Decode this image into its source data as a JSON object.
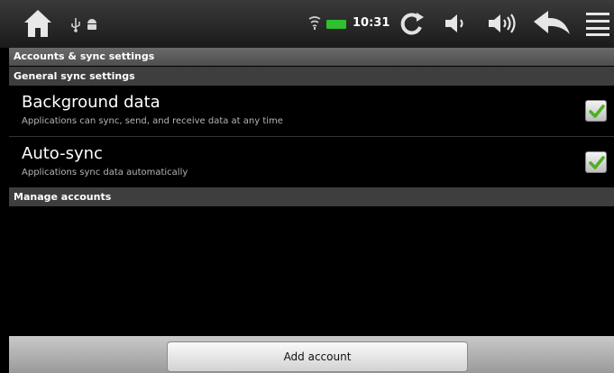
{
  "status_bar": {
    "time": "10:31",
    "left_icons": [
      "home-icon",
      "usb-icon",
      "android-debug-icon"
    ],
    "right_icons": [
      "wifi-icon",
      "battery-icon",
      "refresh-icon",
      "volume-down-icon",
      "volume-up-icon",
      "back-icon",
      "menu-icon"
    ],
    "battery_color": "#2fbf2f"
  },
  "screen": {
    "title": "Accounts & sync settings",
    "general_header": "General sync settings",
    "settings": [
      {
        "title": "Background data",
        "summary": "Applications can sync, send, and receive data at any time",
        "checked": true
      },
      {
        "title": "Auto-sync",
        "summary": "Applications sync data automatically",
        "checked": true
      }
    ],
    "manage_header": "Manage accounts",
    "add_account_label": "Add account"
  },
  "colors": {
    "check": "#4caf1e",
    "header_bg": "#3e3e3e"
  }
}
